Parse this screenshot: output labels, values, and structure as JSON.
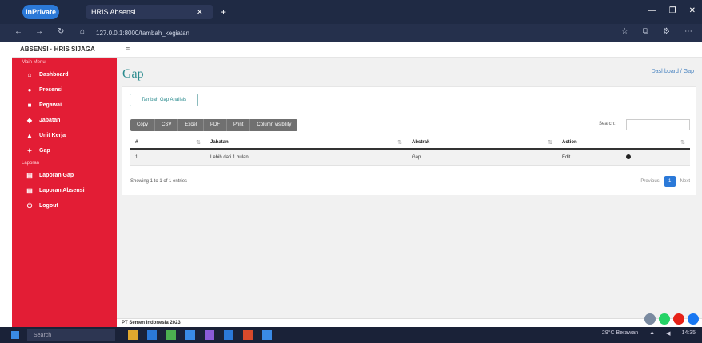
{
  "browser": {
    "profile_label": "InPrivate",
    "tab_title": "HRIS Absensi",
    "tab_close": "✕",
    "new_tab": "+",
    "address": "127.0.0.1:8000/tambah_kegiatan",
    "window_controls": [
      "—",
      "❐",
      "✕"
    ]
  },
  "app": {
    "brand": "ABSENSI · HRIS SIJAGA",
    "menu_toggle": "≡"
  },
  "sidebar": {
    "header_main": "Main Menu",
    "items": [
      {
        "label": "Dashboard",
        "icon": "home-icon"
      },
      {
        "label": "Presensi",
        "icon": "user-icon"
      },
      {
        "label": "Pegawai",
        "icon": "users-icon"
      },
      {
        "label": "Jabatan",
        "icon": "briefcase-icon"
      },
      {
        "label": "Unit Kerja",
        "icon": "building-icon"
      },
      {
        "label": "Gap",
        "icon": "alert-icon"
      }
    ],
    "header_report": "Laporan",
    "report_items": [
      {
        "label": "Laporan Gap",
        "icon": "file-icon"
      },
      {
        "label": "Laporan Absensi",
        "icon": "file-icon"
      }
    ],
    "logout": "Logout"
  },
  "content": {
    "title": "Gap",
    "breadcrumb": "Dashboard / Gap",
    "add_button": "Tambah Gap Analisis",
    "export_buttons": [
      "Copy",
      "CSV",
      "Excel",
      "PDF",
      "Print",
      "Column visibility"
    ],
    "search_label": "Search:",
    "search_value": "",
    "table": {
      "headers": [
        "#",
        "Jabatan",
        "Abstrak",
        "Action"
      ],
      "rows": [
        {
          "no": "1",
          "jabatan": "Lebih dari 1 bulan",
          "abstrak": "Gap",
          "action": "Edit"
        }
      ]
    },
    "info": "Showing 1 to 1 of 1 entries",
    "pager": {
      "prev": "Previous",
      "current": "1",
      "next": "Next"
    }
  },
  "footer": {
    "text": "PT Semen Indonesia 2023"
  },
  "taskbar": {
    "search_placeholder": "Search",
    "weather": "29°C Berawan",
    "clock": "14:35"
  },
  "colors": {
    "sidebar": "#e31d35",
    "title": "#2a8b8e",
    "accent": "#2b79d8"
  }
}
